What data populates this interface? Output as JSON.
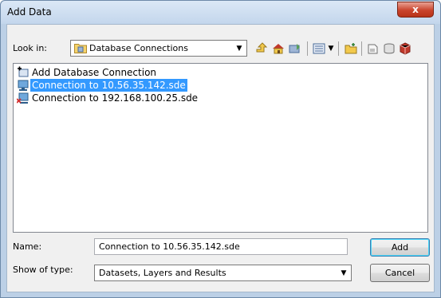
{
  "window": {
    "title": "Add Data",
    "close_glyph": "x"
  },
  "lookin": {
    "label": "Look in:",
    "value": "Database Connections",
    "folder_icon": "database-folder-icon"
  },
  "toolbar": {
    "icons": [
      "up-one-level-icon",
      "home-icon",
      "connect-to-folder-icon",
      "toggle-contents-view-icon",
      "contents-view-dropdown-icon",
      "new-folder-icon",
      "new-file-geodatabase-icon",
      "new-personal-geodatabase-icon",
      "new-cache-icon"
    ]
  },
  "file_list": {
    "items": [
      {
        "label": "Add Database Connection",
        "icon": "add-database-connection-icon",
        "selected": false
      },
      {
        "label": "Connection to 10.56.35.142.sde",
        "icon": "sde-connection-icon",
        "selected": true
      },
      {
        "label": "Connection to 192.168.100.25.sde",
        "icon": "sde-connection-error-icon",
        "selected": false
      }
    ]
  },
  "name_field": {
    "label": "Name:",
    "value": "Connection to 10.56.35.142.sde"
  },
  "type_field": {
    "label": "Show of type:",
    "value": "Datasets, Layers and Results"
  },
  "buttons": {
    "add": "Add",
    "cancel": "Cancel"
  },
  "colors": {
    "selection": "#3399ff",
    "window_frame": "#bcd0e6",
    "client_bg": "#f0f0f0"
  }
}
